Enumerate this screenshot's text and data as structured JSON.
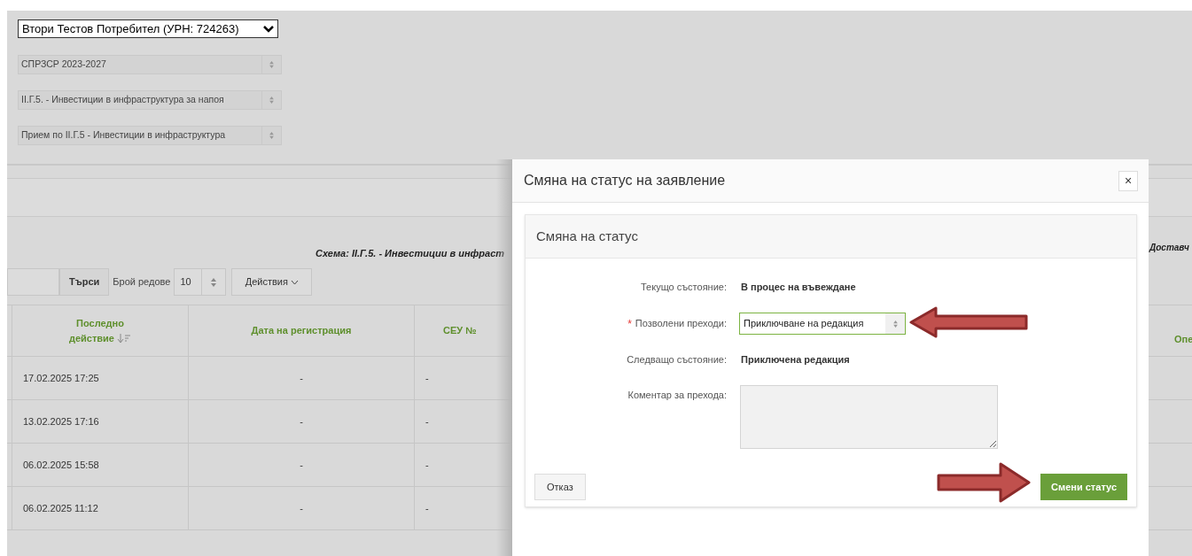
{
  "filters": {
    "consumer_select": "Втори Тестов Потребител (УРН: 724263)",
    "selects": [
      "СПРЗСР 2023-2027",
      "II.Г.5. - Инвестиции в инфраструктура за напоя",
      "Прием по II.Г.5 - Инвестиции в инфраструктура"
    ]
  },
  "scheme_heading": "Схема: II.Г.5. - Инвестиции в инфраст",
  "right_heading_fragment": "Доставч",
  "toolbar": {
    "search_button": "Търси",
    "rows_label": "Брой редове",
    "rows_value": "10",
    "actions_button": "Действия"
  },
  "table": {
    "columns": [
      {
        "label": "Последно действие",
        "sorted": true
      },
      {
        "label": "Дата на регистрация",
        "sorted": false
      },
      {
        "label": "СЕУ №",
        "sorted": false
      }
    ],
    "rows": [
      [
        "17.02.2025 17:25",
        "-",
        "-"
      ],
      [
        "13.02.2025 17:16",
        "-",
        "-"
      ],
      [
        "06.02.2025 15:58",
        "-",
        "-"
      ],
      [
        "06.02.2025 11:12",
        "-",
        "-"
      ]
    ],
    "partial_column": "Опе"
  },
  "modal": {
    "title": "Смяна на статус на заявление",
    "close": "×",
    "panel_title": "Смяна на статус",
    "fields": [
      {
        "kind": "text",
        "label": "Текущо състояние:",
        "value": "В процес на въвеждане"
      },
      {
        "kind": "select",
        "label": "Позволени преходи:",
        "value": "Приключване на редакция",
        "required_marker": "*"
      },
      {
        "kind": "text",
        "label": "Следващо състояние:",
        "value": "Приключена редакция"
      },
      {
        "kind": "textarea",
        "label": "Коментар за прехода:"
      }
    ],
    "cancel_button": "Отказ",
    "submit_button": "Смени статус"
  }
}
